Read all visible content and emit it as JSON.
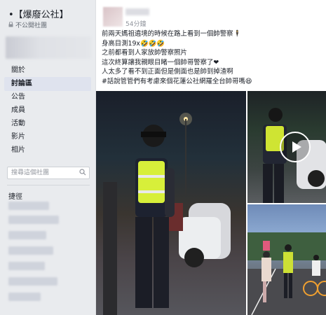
{
  "group": {
    "title": "•【爆廢公社】",
    "privacy_label": "不公開社團"
  },
  "nav": {
    "about": "關於",
    "discussion": "討論區",
    "announcements": "公告",
    "members": "成員",
    "events": "活動",
    "videos": "影片",
    "photos": "相片"
  },
  "search": {
    "placeholder": "搜尋這個社團"
  },
  "shortcuts": {
    "title": "捷徑"
  },
  "post": {
    "timestamp": "54分鐘",
    "lines": [
      "前兩天媽祖遶境的時候在路上看到一個帥警察🕴",
      "身高目測19x🤣🤣🤣",
      "之前都看到人家放帥警察照片",
      "這次終算讓我親眼目睹一個帥哥警察了❤",
      "人太多了看不到正面但是側面也是帥到掉渣啊",
      "#話說管管們有考慮來個花蓮公社網羅全台帥哥嗎😆"
    ]
  },
  "colors": {
    "active_nav_bg": "#dfe3ee",
    "page_bg": "#e9ebee"
  }
}
